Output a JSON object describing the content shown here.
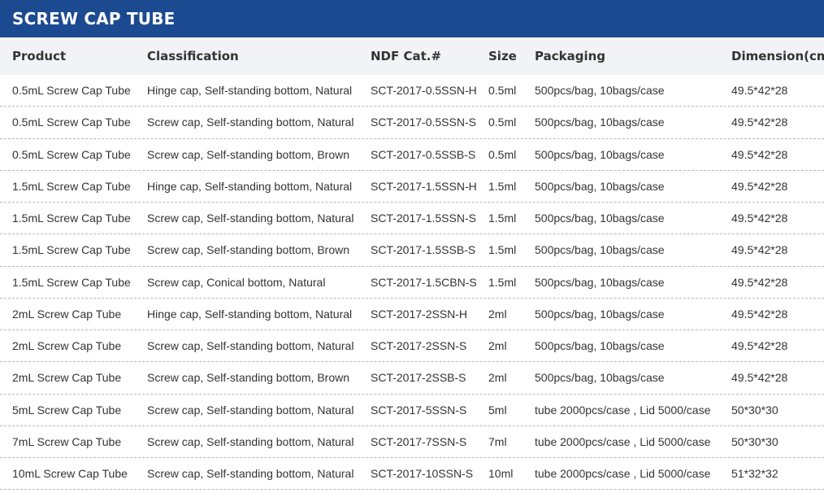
{
  "title": "SCREW CAP TUBE",
  "columns": [
    "Product",
    "Classification",
    "NDF Cat.#",
    "Size",
    "Packaging",
    "Dimension(cm)"
  ],
  "rows": [
    [
      "0.5mL Screw Cap Tube",
      "Hinge cap, Self-standing  bottom, Natural",
      "SCT-2017-0.5SSN-H",
      "0.5ml",
      "500pcs/bag, 10bags/case",
      "49.5*42*28"
    ],
    [
      "0.5mL Screw Cap Tube",
      "Screw cap, Self-standing bottom, Natural",
      "SCT-2017-0.5SSN-S",
      "0.5ml",
      "500pcs/bag, 10bags/case",
      "49.5*42*28"
    ],
    [
      "0.5mL Screw Cap Tube",
      "Screw cap, Self-standing bottom, Brown",
      "SCT-2017-0.5SSB-S",
      "0.5ml",
      "500pcs/bag, 10bags/case",
      "49.5*42*28"
    ],
    [
      "1.5mL Screw Cap Tube",
      "Hinge cap, Self-standing  bottom, Natural",
      "SCT-2017-1.5SSN-H",
      "1.5ml",
      "500pcs/bag, 10bags/case",
      "49.5*42*28"
    ],
    [
      "1.5mL Screw Cap Tube",
      "Screw cap, Self-standing bottom, Natural",
      "SCT-2017-1.5SSN-S",
      "1.5ml",
      "500pcs/bag, 10bags/case",
      "49.5*42*28"
    ],
    [
      "1.5mL Screw Cap Tube",
      "Screw cap, Self-standing bottom, Brown",
      "SCT-2017-1.5SSB-S",
      "1.5ml",
      "500pcs/bag, 10bags/case",
      "49.5*42*28"
    ],
    [
      "1.5mL Screw Cap Tube",
      "Screw cap, Conical bottom, Natural",
      "SCT-2017-1.5CBN-S",
      "1.5ml",
      "500pcs/bag, 10bags/case",
      "49.5*42*28"
    ],
    [
      "2mL Screw Cap Tube",
      "Hinge cap, Self-standing  bottom, Natural",
      "SCT-2017-2SSN-H",
      "2ml",
      "500pcs/bag, 10bags/case",
      "49.5*42*28"
    ],
    [
      "2mL Screw Cap Tube",
      "Screw cap, Self-standing bottom, Natural",
      "SCT-2017-2SSN-S",
      "2ml",
      "500pcs/bag, 10bags/case",
      "49.5*42*28"
    ],
    [
      "2mL Screw Cap Tube",
      "Screw cap, Self-standing bottom, Brown",
      "SCT-2017-2SSB-S",
      "2ml",
      "500pcs/bag, 10bags/case",
      "49.5*42*28"
    ],
    [
      "5mL Screw Cap Tube",
      "Screw cap, Self-standing bottom, Natural",
      "SCT-2017-5SSN-S",
      "5ml",
      "tube 2000pcs/case , Lid 5000/case",
      "50*30*30"
    ],
    [
      "7mL Screw Cap Tube",
      "Screw cap, Self-standing bottom, Natural",
      "SCT-2017-7SSN-S",
      "7ml",
      "tube 2000pcs/case , Lid 5000/case",
      "50*30*30"
    ],
    [
      "10mL Screw Cap Tube",
      "Screw cap, Self-standing bottom, Natural",
      "SCT-2017-10SSN-S",
      "10ml",
      "tube 2000pcs/case , Lid 5000/case",
      "51*32*32"
    ]
  ],
  "colors": {
    "title_bg": "#1b4a90",
    "header_bg": "#f2f3f6",
    "divider": "#b7b7b7"
  }
}
